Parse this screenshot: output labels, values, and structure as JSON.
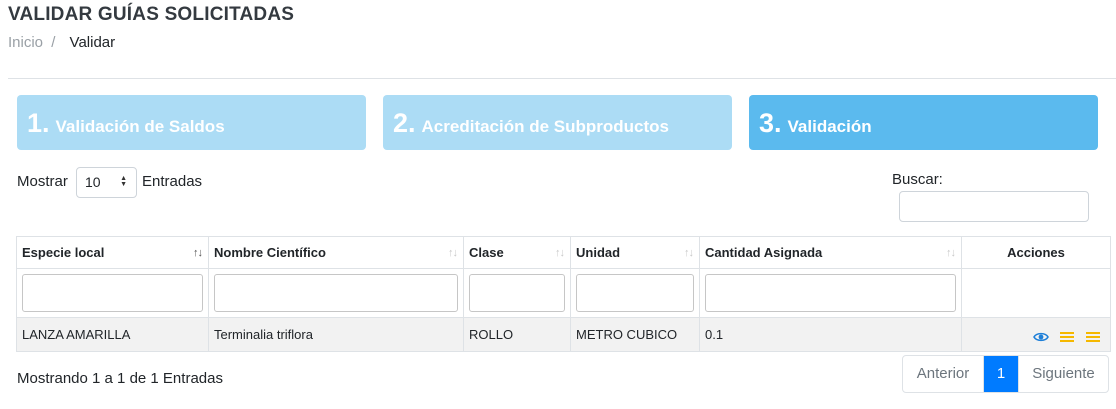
{
  "header": {
    "title": "VALIDAR GUÍAS SOLICITADAS",
    "breadcrumb": {
      "home": "Inicio",
      "separator": "/",
      "current": "Validar"
    }
  },
  "steps": [
    {
      "number": "1.",
      "label": "Validación de Saldos",
      "state": "inactive"
    },
    {
      "number": "2.",
      "label": "Acreditación de Subproductos",
      "state": "inactive"
    },
    {
      "number": "3.",
      "label": "Validación",
      "state": "active"
    }
  ],
  "table_controls": {
    "show_label": "Mostrar",
    "page_size": "10",
    "entries_label": "Entradas",
    "search_label": "Buscar:",
    "search_value": ""
  },
  "table": {
    "columns": [
      "Especie local",
      "Nombre Científico",
      "Clase",
      "Unidad",
      "Cantidad Asignada",
      "Acciones"
    ],
    "rows": [
      {
        "especie_local": "LANZA AMARILLA",
        "nombre_cientifico": "Terminalia triflora",
        "clase": "ROLLO",
        "unidad": "METRO CUBICO",
        "cantidad_asignada": "0.1"
      }
    ]
  },
  "footer": {
    "info": "Mostrando 1 a 1 de 1 Entradas",
    "prev_label": "Anterior",
    "current_page": "1",
    "next_label": "Siguiente"
  },
  "colors": {
    "step_inactive": "#acdcf5",
    "step_active": "#5bbaee",
    "view_icon": "#1e7fd8",
    "menu_icon": "#f5b800",
    "page_active": "#007bff"
  },
  "icons": [
    "eye-icon",
    "list-icon",
    "list-icon"
  ]
}
